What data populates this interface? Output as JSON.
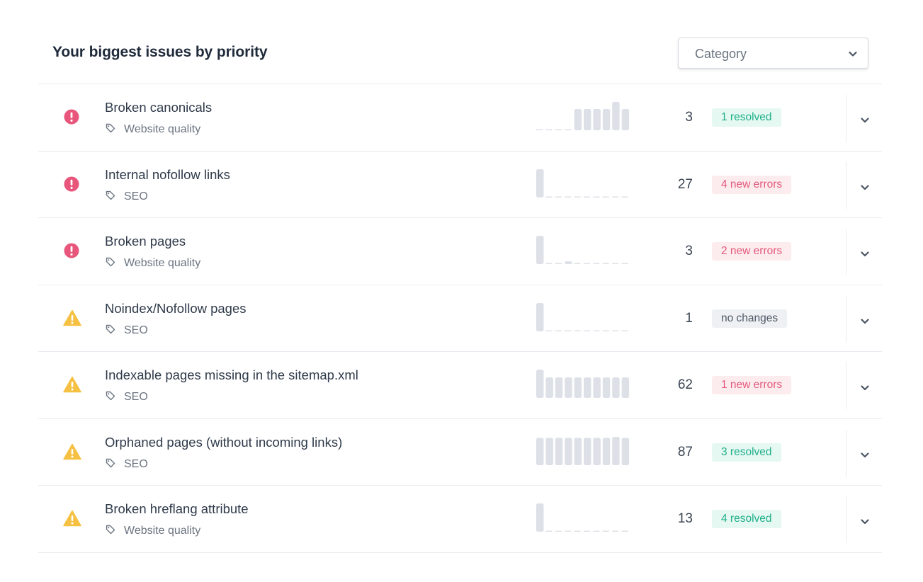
{
  "header": {
    "title": "Your biggest issues by priority",
    "category_label": "Category"
  },
  "colors": {
    "error": "#e8567c",
    "warning": "#f6c143",
    "resolved_text": "#1fb089",
    "resolved_bg": "#e5f8f1",
    "errors_text": "#e2587a",
    "errors_bg": "#fdecee",
    "neutral_text": "#4e5866",
    "neutral_bg": "#eef0f3",
    "spark": "#dde1e7"
  },
  "issues": [
    {
      "title": "Broken canonicals",
      "tag": "Website quality",
      "severity": "error",
      "count": "3",
      "badge": "1 resolved",
      "badge_type": "resolved",
      "trend": [
        0,
        0,
        0,
        0,
        3,
        3,
        3,
        3,
        4,
        3
      ]
    },
    {
      "title": "Internal nofollow links",
      "tag": "SEO",
      "severity": "error",
      "count": "27",
      "badge": "4 new errors",
      "badge_type": "errors",
      "trend": [
        27,
        0,
        0,
        0,
        0,
        0,
        0,
        0,
        0,
        0
      ]
    },
    {
      "title": "Broken pages",
      "tag": "Website quality",
      "severity": "error",
      "count": "3",
      "badge": "2 new errors",
      "badge_type": "errors",
      "trend": [
        3,
        0,
        0,
        0.3,
        0,
        0,
        0,
        0,
        0,
        0
      ]
    },
    {
      "title": "Noindex/Nofollow pages",
      "tag": "SEO",
      "severity": "warning",
      "count": "1",
      "badge": "no changes",
      "badge_type": "neutral",
      "trend": [
        1,
        0,
        0,
        0,
        0,
        0,
        0,
        0,
        0,
        0
      ]
    },
    {
      "title": "Indexable pages missing in the sitemap.xml",
      "tag": "SEO",
      "severity": "warning",
      "count": "62",
      "badge": "1 new errors",
      "badge_type": "errors",
      "trend": [
        62,
        45,
        45,
        45,
        45,
        45,
        45,
        45,
        45,
        45
      ]
    },
    {
      "title": "Orphaned pages (without incoming links)",
      "tag": "SEO",
      "severity": "warning",
      "count": "87",
      "badge": "3 resolved",
      "badge_type": "resolved",
      "trend": [
        87,
        87,
        87,
        87,
        87,
        87,
        87,
        87,
        90,
        87
      ]
    },
    {
      "title": "Broken hreflang attribute",
      "tag": "Website quality",
      "severity": "warning",
      "count": "13",
      "badge": "4 resolved",
      "badge_type": "resolved",
      "trend": [
        13,
        0,
        0,
        0,
        0,
        0,
        0,
        0,
        0,
        0
      ]
    }
  ]
}
